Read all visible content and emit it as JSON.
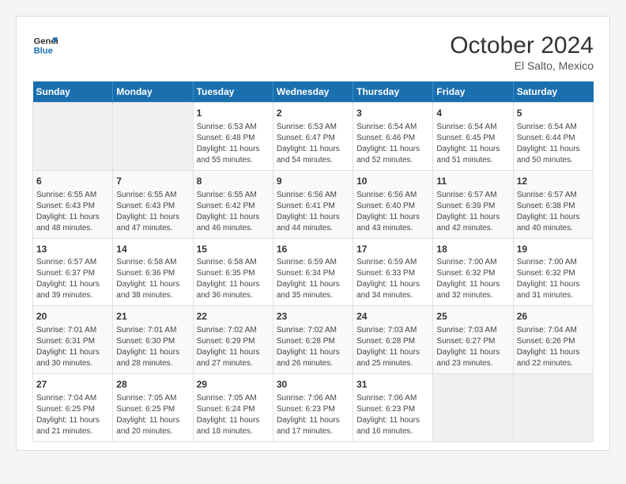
{
  "logo": {
    "line1": "General",
    "line2": "Blue"
  },
  "title": "October 2024",
  "location": "El Salto, Mexico",
  "days_header": [
    "Sunday",
    "Monday",
    "Tuesday",
    "Wednesday",
    "Thursday",
    "Friday",
    "Saturday"
  ],
  "weeks": [
    [
      {
        "day": "",
        "info": ""
      },
      {
        "day": "",
        "info": ""
      },
      {
        "day": "1",
        "info": "Sunrise: 6:53 AM\nSunset: 6:48 PM\nDaylight: 11 hours and 55 minutes."
      },
      {
        "day": "2",
        "info": "Sunrise: 6:53 AM\nSunset: 6:47 PM\nDaylight: 11 hours and 54 minutes."
      },
      {
        "day": "3",
        "info": "Sunrise: 6:54 AM\nSunset: 6:46 PM\nDaylight: 11 hours and 52 minutes."
      },
      {
        "day": "4",
        "info": "Sunrise: 6:54 AM\nSunset: 6:45 PM\nDaylight: 11 hours and 51 minutes."
      },
      {
        "day": "5",
        "info": "Sunrise: 6:54 AM\nSunset: 6:44 PM\nDaylight: 11 hours and 50 minutes."
      }
    ],
    [
      {
        "day": "6",
        "info": "Sunrise: 6:55 AM\nSunset: 6:43 PM\nDaylight: 11 hours and 48 minutes."
      },
      {
        "day": "7",
        "info": "Sunrise: 6:55 AM\nSunset: 6:43 PM\nDaylight: 11 hours and 47 minutes."
      },
      {
        "day": "8",
        "info": "Sunrise: 6:55 AM\nSunset: 6:42 PM\nDaylight: 11 hours and 46 minutes."
      },
      {
        "day": "9",
        "info": "Sunrise: 6:56 AM\nSunset: 6:41 PM\nDaylight: 11 hours and 44 minutes."
      },
      {
        "day": "10",
        "info": "Sunrise: 6:56 AM\nSunset: 6:40 PM\nDaylight: 11 hours and 43 minutes."
      },
      {
        "day": "11",
        "info": "Sunrise: 6:57 AM\nSunset: 6:39 PM\nDaylight: 11 hours and 42 minutes."
      },
      {
        "day": "12",
        "info": "Sunrise: 6:57 AM\nSunset: 6:38 PM\nDaylight: 11 hours and 40 minutes."
      }
    ],
    [
      {
        "day": "13",
        "info": "Sunrise: 6:57 AM\nSunset: 6:37 PM\nDaylight: 11 hours and 39 minutes."
      },
      {
        "day": "14",
        "info": "Sunrise: 6:58 AM\nSunset: 6:36 PM\nDaylight: 11 hours and 38 minutes."
      },
      {
        "day": "15",
        "info": "Sunrise: 6:58 AM\nSunset: 6:35 PM\nDaylight: 11 hours and 36 minutes."
      },
      {
        "day": "16",
        "info": "Sunrise: 6:59 AM\nSunset: 6:34 PM\nDaylight: 11 hours and 35 minutes."
      },
      {
        "day": "17",
        "info": "Sunrise: 6:59 AM\nSunset: 6:33 PM\nDaylight: 11 hours and 34 minutes."
      },
      {
        "day": "18",
        "info": "Sunrise: 7:00 AM\nSunset: 6:32 PM\nDaylight: 11 hours and 32 minutes."
      },
      {
        "day": "19",
        "info": "Sunrise: 7:00 AM\nSunset: 6:32 PM\nDaylight: 11 hours and 31 minutes."
      }
    ],
    [
      {
        "day": "20",
        "info": "Sunrise: 7:01 AM\nSunset: 6:31 PM\nDaylight: 11 hours and 30 minutes."
      },
      {
        "day": "21",
        "info": "Sunrise: 7:01 AM\nSunset: 6:30 PM\nDaylight: 11 hours and 28 minutes."
      },
      {
        "day": "22",
        "info": "Sunrise: 7:02 AM\nSunset: 6:29 PM\nDaylight: 11 hours and 27 minutes."
      },
      {
        "day": "23",
        "info": "Sunrise: 7:02 AM\nSunset: 6:28 PM\nDaylight: 11 hours and 26 minutes."
      },
      {
        "day": "24",
        "info": "Sunrise: 7:03 AM\nSunset: 6:28 PM\nDaylight: 11 hours and 25 minutes."
      },
      {
        "day": "25",
        "info": "Sunrise: 7:03 AM\nSunset: 6:27 PM\nDaylight: 11 hours and 23 minutes."
      },
      {
        "day": "26",
        "info": "Sunrise: 7:04 AM\nSunset: 6:26 PM\nDaylight: 11 hours and 22 minutes."
      }
    ],
    [
      {
        "day": "27",
        "info": "Sunrise: 7:04 AM\nSunset: 6:25 PM\nDaylight: 11 hours and 21 minutes."
      },
      {
        "day": "28",
        "info": "Sunrise: 7:05 AM\nSunset: 6:25 PM\nDaylight: 11 hours and 20 minutes."
      },
      {
        "day": "29",
        "info": "Sunrise: 7:05 AM\nSunset: 6:24 PM\nDaylight: 11 hours and 18 minutes."
      },
      {
        "day": "30",
        "info": "Sunrise: 7:06 AM\nSunset: 6:23 PM\nDaylight: 11 hours and 17 minutes."
      },
      {
        "day": "31",
        "info": "Sunrise: 7:06 AM\nSunset: 6:23 PM\nDaylight: 11 hours and 16 minutes."
      },
      {
        "day": "",
        "info": ""
      },
      {
        "day": "",
        "info": ""
      }
    ]
  ]
}
